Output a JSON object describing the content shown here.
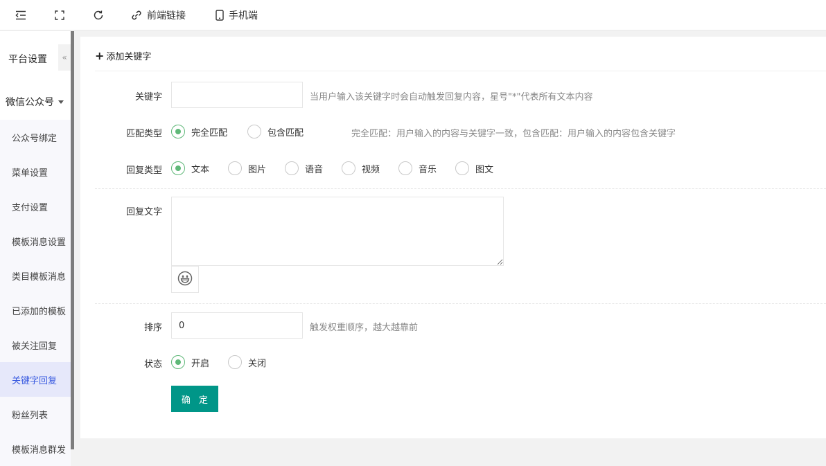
{
  "topbar": {
    "frontend_link": "前端链接",
    "mobile": "手机端"
  },
  "sidebar": {
    "title": "平台设置",
    "collapse_glyph": "«",
    "group": "微信公众号",
    "items": [
      {
        "label": "公众号绑定"
      },
      {
        "label": "菜单设置"
      },
      {
        "label": "支付设置"
      },
      {
        "label": "模板消息设置"
      },
      {
        "label": "类目模板消息"
      },
      {
        "label": "已添加的模板"
      },
      {
        "label": "被关注回复"
      },
      {
        "label": "关键字回复",
        "active": true
      },
      {
        "label": "粉丝列表"
      },
      {
        "label": "模板消息群发"
      }
    ]
  },
  "form": {
    "add_label": "添加关键字",
    "keyword": {
      "label": "关键字",
      "value": "",
      "hint": "当用户输入该关键字时会自动触发回复内容，星号\"*\"代表所有文本内容"
    },
    "match": {
      "label": "匹配类型",
      "options": [
        "完全匹配",
        "包含匹配"
      ],
      "selected": "完全匹配",
      "hint": "完全匹配：用户输入的内容与关键字一致，包含匹配：用户输入的内容包含关键字"
    },
    "reply_type": {
      "label": "回复类型",
      "options": [
        "文本",
        "图片",
        "语音",
        "视频",
        "音乐",
        "图文"
      ],
      "selected": "文本"
    },
    "reply_text": {
      "label": "回复文字",
      "value": ""
    },
    "sort": {
      "label": "排序",
      "value": "0",
      "hint": "触发权重顺序，越大越靠前"
    },
    "status": {
      "label": "状态",
      "options": [
        "开启",
        "关闭"
      ],
      "selected": "开启"
    },
    "submit_label": "确 定"
  },
  "colors": {
    "accent": "#009688",
    "radio_checked": "#5fb878",
    "active_menu_bg": "#e6e8fa",
    "active_menu_text": "#3a5be0"
  }
}
